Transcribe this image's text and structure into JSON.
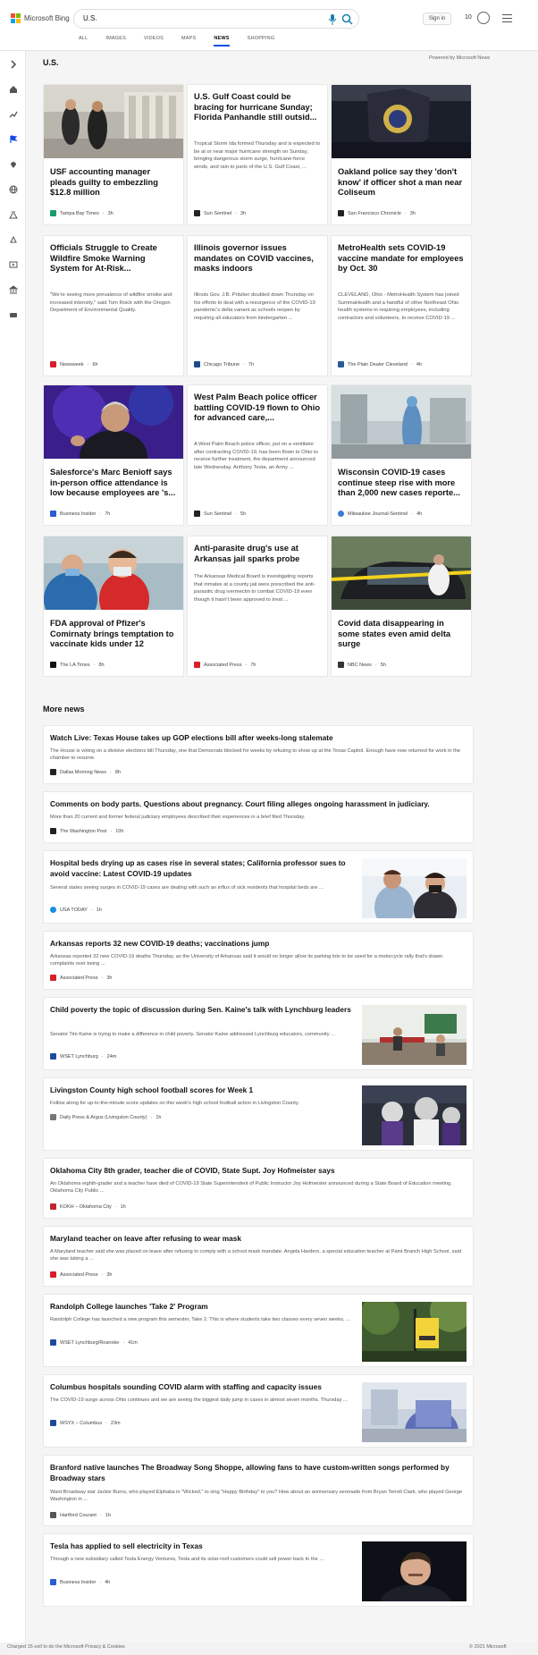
{
  "header": {
    "brand": "Microsoft Bing",
    "search_value": "U.S.",
    "sign_in": "Sign in",
    "rewards_count": "10",
    "tabs": [
      {
        "label": "ALL"
      },
      {
        "label": "IMAGES"
      },
      {
        "label": "VIDEOS"
      },
      {
        "label": "MAPS"
      },
      {
        "label": "NEWS"
      },
      {
        "label": "SHOPPING"
      }
    ],
    "active_tab": "NEWS"
  },
  "section": {
    "title": "U.S.",
    "powered": "Powered by Microsoft News"
  },
  "cards": [
    {
      "title": "USF accounting manager pleads guilty to embezzling $12.8 million",
      "summary": "",
      "source": "Tampa Bay Times",
      "time": "3h",
      "logo_color": "#1a9c6b"
    },
    {
      "title": "U.S. Gulf Coast could be bracing for hurricane Sunday; Florida Panhandle still outsid...",
      "summary": "Tropical Storm Ida formed Thursday and is expected to be at or near major hurricane strength on Sunday, bringing dangerous storm surge, hurricane-force winds, and rain to parts of the U.S. Gulf Coast, ...",
      "source": "Sun Sentinel",
      "time": "3h",
      "logo_color": "#222222"
    },
    {
      "title": "Oakland police say they 'don't know' if officer shot a man near Coliseum",
      "summary": "",
      "source": "San Francisco Chronicle",
      "time": "3h",
      "logo_color": "#222222"
    },
    {
      "title": "Officials Struggle to Create Wildfire Smoke Warning System for At-Risk...",
      "summary": "\"We're seeing more prevalence of wildfire smoke and increased intensity,\" said Tom Roick with the Oregon Department of Environmental Quality.",
      "source": "Newsweek",
      "time": "6h",
      "logo_color": "#d62028"
    },
    {
      "title": "Illinois governor issues mandates on COVID vaccines, masks indoors",
      "summary": "Illinois Gov. J.B. Pritzker doubled down Thursday on his efforts to deal with a resurgence of the COVID-19 pandemic's delta variant as schools reopen by requiring all educators from kindergarten ...",
      "source": "Chicago Tribune",
      "time": "7h",
      "logo_color": "#1e4a8c"
    },
    {
      "title": "MetroHealth sets COVID-19 vaccine mandate for employees by Oct. 30",
      "summary": "CLEVELAND, Ohio - MetroHealth System has joined SummaHealth and a handful of other Northeast Ohio health systems in requiring employees, including contractors and volunteers, to receive COVID-19 ...",
      "source": "The Plain Dealer Cleveland",
      "time": "4h",
      "logo_color": "#2a5a9a"
    },
    {
      "title": "Salesforce's Marc Benioff says in-person office attendance is low because employees are 's...",
      "summary": "",
      "source": "Business Insider",
      "time": "7h",
      "logo_color": "#2a5bd7"
    },
    {
      "title": "West Palm Beach police officer battling COVID-19 flown to Ohio for advanced care,...",
      "summary": "A West Palm Beach police officer, put on a ventilator after contracting COVID-19, has been flown to Ohio to receive further treatment, the department announced late Wednesday. Anthony Testa, an Army ...",
      "source": "Sun Sentinel",
      "time": "5h",
      "logo_color": "#222222"
    },
    {
      "title": "Wisconsin COVID-19 cases continue steep rise with more than 2,000 new cases reporte...",
      "summary": "",
      "source": "Milwaukee Journal-Sentinel",
      "time": "4h",
      "logo_color": "#3a7bd5"
    },
    {
      "title": "FDA approval of Pfizer's Comirnaty brings temptation to vaccinate kids under 12",
      "summary": "",
      "source": "The LA Times",
      "time": "8h",
      "logo_color": "#111111"
    },
    {
      "title": "Anti-parasite drug's use at Arkansas jail sparks probe",
      "summary": "The Arkansas Medical Board is investigating reports that inmates at a county jail were prescribed the anti-parasitic drug ivermectin to combat COVID-19 even though it hasn't been approved to treat ...",
      "source": "Associated Press",
      "time": "7h",
      "logo_color": "#d62028"
    },
    {
      "title": "Covid data disappearing in some states even amid delta surge",
      "summary": "",
      "source": "NBC News",
      "time": "5h",
      "logo_color": "#333333"
    }
  ],
  "more": {
    "title": "More news",
    "items": [
      {
        "title": "Watch Live: Texas House takes up GOP elections bill after weeks-long stalemate",
        "summary": "The House is voting on a divisive elections bill Thursday, one that Democrats blocked for weeks by refusing to show up at the Texas Capitol. Enough have now returned for work in the chamber to resume.",
        "source": "Dallas Morning News",
        "time": "8h",
        "logo_color": "#222222"
      },
      {
        "title": "Comments on body parts. Questions about pregnancy. Court filing alleges ongoing harassment in judiciary.",
        "summary": "More than 20 current and former federal judiciary employees described their experiences in a brief filed Thursday.",
        "source": "The Washington Post",
        "time": "10h",
        "logo_color": "#222222"
      },
      {
        "title": "Hospital beds drying up as cases rise in several states; California professor sues to avoid vaccine: Latest COVID-19 updates",
        "summary": "Several states seeing surges in COVID-19 cases are dealing with such an influx of sick residents that hospital beds are ...",
        "source": "USA TODAY",
        "time": "1h",
        "logo_color": "#1a8fe3"
      },
      {
        "title": "Arkansas reports 32 new COVID-19 deaths; vaccinations jump",
        "summary": "Arkansas reported 32 new COVID-19 deaths Thursday, as the University of Arkansas said it would no longer allow its parking lots to be used for a motorcycle rally that's drawn complaints over being ...",
        "source": "Associated Press",
        "time": "3h",
        "logo_color": "#d62028"
      },
      {
        "title": "Child poverty the topic of discussion during Sen. Kaine's talk with Lynchburg leaders",
        "summary": "Senator Tim Kaine is trying to make a difference in child poverty. Senator Kaine addressed Lynchburg educators, community ...",
        "source": "WSET Lynchburg",
        "time": "24m",
        "logo_color": "#1e4a9c"
      },
      {
        "title": "Livingston County high school football scores for Week 1",
        "summary": "Follow along for up-to-the-minute score updates on this week's high school football action in Livingston County.",
        "source": "Daily Press & Argus (Livingston County)",
        "time": "1h",
        "logo_color": "#777777"
      },
      {
        "title": "Oklahoma City 8th grader, teacher die of COVID, State Supt. Joy Hofmeister says",
        "summary": "An Oklahoma eighth-grader and a teacher have died of COVID-19 State Superintendent of Public Instructor Joy Hofmeister announced during a State Board of Education meeting. Oklahoma City Public ...",
        "source": "KOKH – Oklahoma City",
        "time": "1h",
        "logo_color": "#c0262d"
      },
      {
        "title": "Maryland teacher on leave after refusing to wear mask",
        "summary": "A Maryland teacher said she was placed on leave after refusing to comply with a school mask mandate. Angela Harders, a special education teacher at Paint Branch High School, said she was taking a ...",
        "source": "Associated Press",
        "time": "3h",
        "logo_color": "#d62028"
      },
      {
        "title": "Randolph College launches 'Take 2' Program",
        "summary": "Randolph College has launched a new program this semester, Take 2. This is where students take two classes every seven weeks, ...",
        "source": "WSET Lynchburg/Roanoke",
        "time": "41m",
        "logo_color": "#1e4a9c"
      },
      {
        "title": "Columbus hospitals sounding COVID alarm with staffing and capacity issues",
        "summary": "The COVID-19 surge across Ohio continues and we are seeing the biggest daily jump in cases in almost seven months. Thursday ...",
        "source": "WSYX – Columbus",
        "time": "23m",
        "logo_color": "#1e4a9c"
      },
      {
        "title": "Branford native launches The Broadway Song Shoppe, allowing fans to have custom-written songs performed by Broadway stars",
        "summary": "Want Broadway star Jackie Burns, who played Elphaba in \"Wicked,\" to sing \"Happy Birthday\" to you? How about an anniversary serenade from Bryan Terrell Clark, who played George Washington in ...",
        "source": "Hartford Courant",
        "time": "1h",
        "logo_color": "#555555"
      },
      {
        "title": "Tesla has applied to sell electricity in Texas",
        "summary": "Through a new subsidiary called Tesla Energy Ventures, Tesla and its solar-roof customers could sell power back to the ...",
        "source": "Business Insider",
        "time": "4h",
        "logo_color": "#2a5bd7"
      }
    ]
  },
  "footer": {
    "left": "Charged 15-cell to do the Microsoft Privacy & Cookies",
    "right": "© 2021 Microsoft"
  },
  "colors": {
    "accent": "#174ae4",
    "bing_teal": "#1a9c9c"
  }
}
